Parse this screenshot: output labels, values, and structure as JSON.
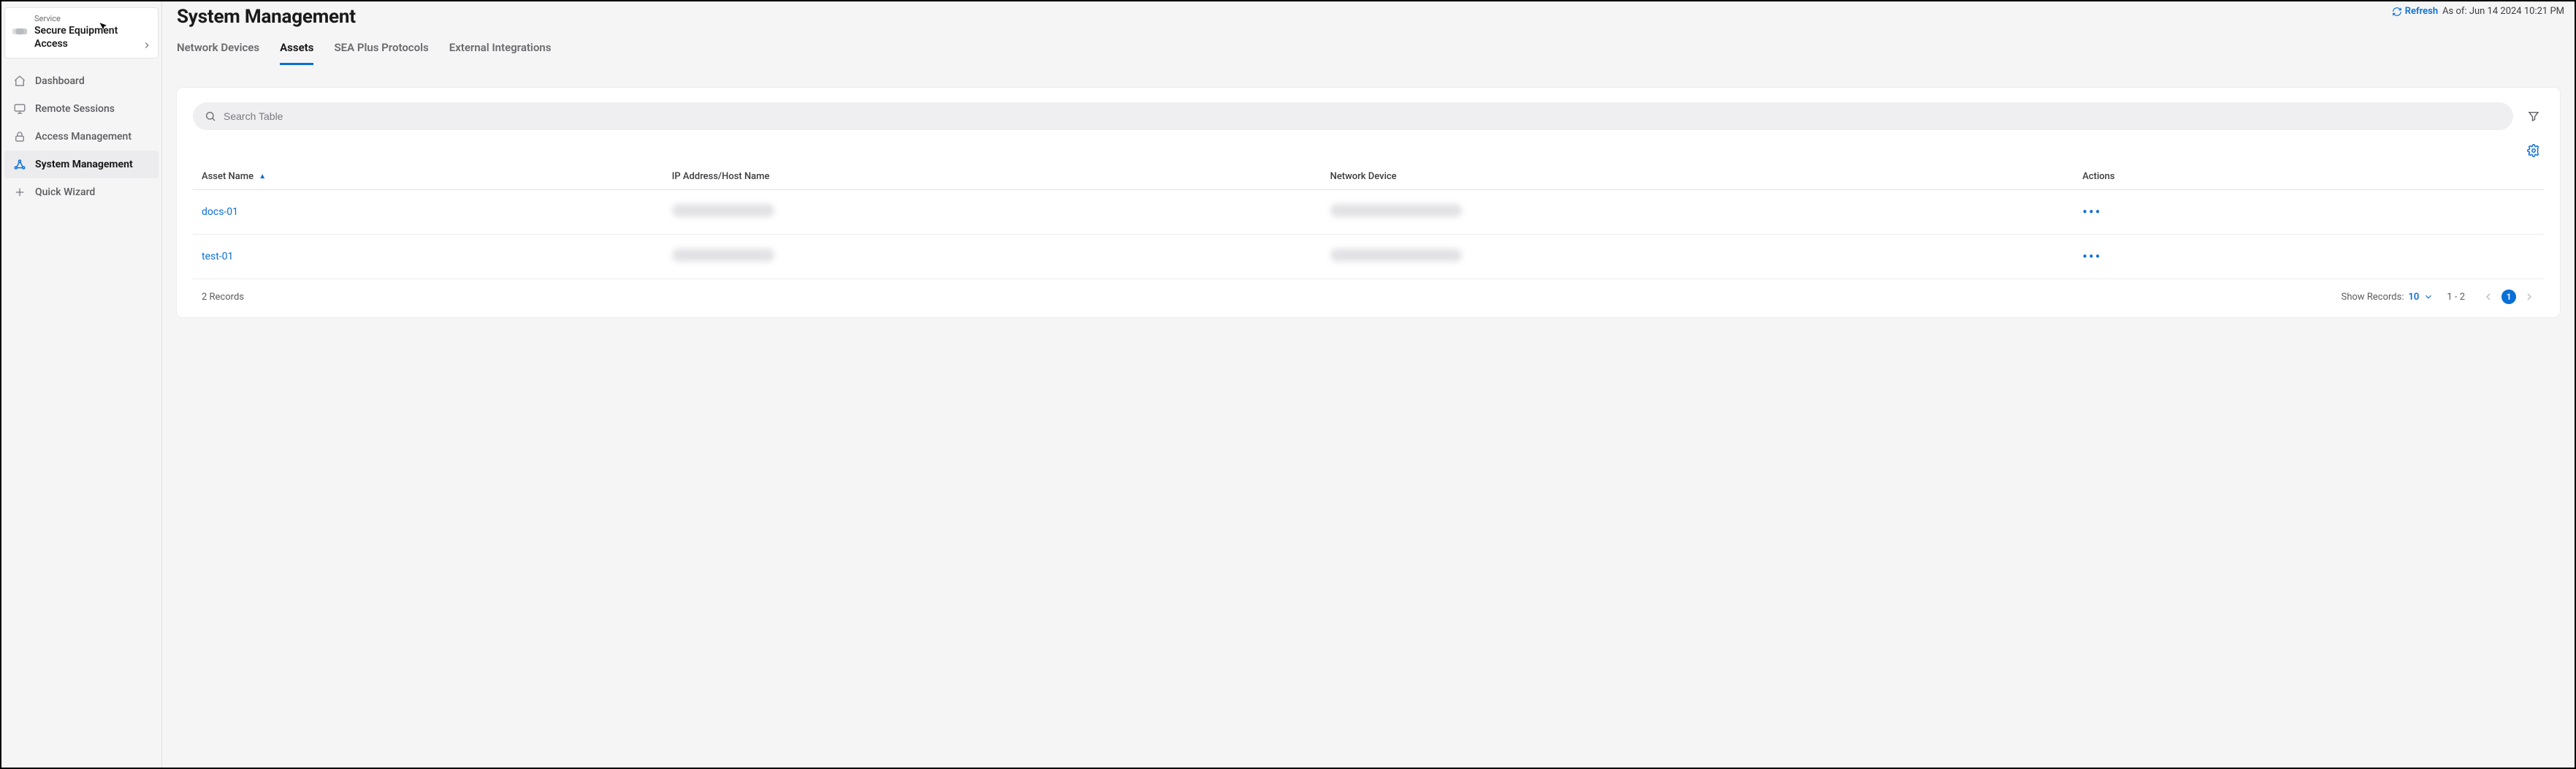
{
  "service": {
    "kicker": "Service",
    "name": "Secure Equipment Access"
  },
  "nav": [
    {
      "id": "dashboard",
      "label": "Dashboard",
      "icon": "home-icon"
    },
    {
      "id": "remote-sessions",
      "label": "Remote Sessions",
      "icon": "monitor-icon"
    },
    {
      "id": "access-management",
      "label": "Access Management",
      "icon": "lock-icon"
    },
    {
      "id": "system-management",
      "label": "System Management",
      "icon": "topology-icon",
      "active": true
    },
    {
      "id": "quick-wizard",
      "label": "Quick Wizard",
      "icon": "wizard-icon"
    }
  ],
  "header": {
    "title": "System Management",
    "refresh_label": "Refresh",
    "asof_prefix": "As of:",
    "asof_value": "Jun 14 2024 10:21 PM"
  },
  "tabs": [
    {
      "id": "network-devices",
      "label": "Network Devices"
    },
    {
      "id": "assets",
      "label": "Assets",
      "active": true
    },
    {
      "id": "sea-plus-protocols",
      "label": "SEA Plus Protocols"
    },
    {
      "id": "external-integrations",
      "label": "External Integrations"
    }
  ],
  "search": {
    "placeholder": "Search Table",
    "value": ""
  },
  "columns": {
    "asset_name": "Asset Name",
    "ip_host": "IP Address/Host Name",
    "net_device": "Network Device",
    "actions": "Actions",
    "sort": {
      "column": "asset_name",
      "dir": "asc"
    }
  },
  "rows": [
    {
      "asset_name": "docs-01",
      "ip_host_redacted": true,
      "net_device_redacted": true
    },
    {
      "asset_name": "test-01",
      "ip_host_redacted": true,
      "net_device_redacted": true
    }
  ],
  "footer": {
    "records_text": "2 Records",
    "show_records_label": "Show Records:",
    "page_size": "10",
    "range": "1 - 2",
    "current_page": "1"
  },
  "colors": {
    "accent": "#0a6fd6",
    "bg": "#f5f5f6",
    "panel": "#ffffff"
  }
}
